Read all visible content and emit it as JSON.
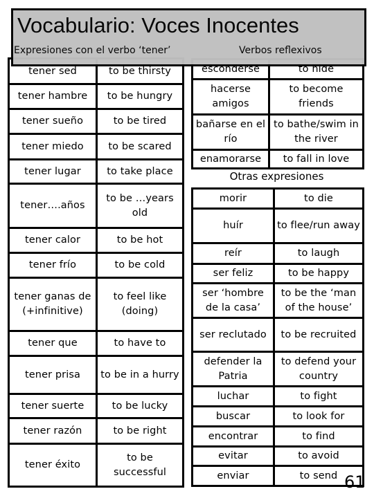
{
  "header": {
    "title": "Vocabulario: Voces Inocentes",
    "section_left": "Expresiones con el verbo ‘tener’",
    "section_right": "Verbos reflexivos"
  },
  "tener_expressions": [
    {
      "es": "tener sed",
      "en": "to be thirsty"
    },
    {
      "es": "tener hambre",
      "en": "to be hungry"
    },
    {
      "es": "tener sueño",
      "en": "to be tired"
    },
    {
      "es": "tener miedo",
      "en": "to be scared"
    },
    {
      "es": "tener lugar",
      "en": "to take place"
    },
    {
      "es": "tener….años",
      "en": "to be …years old"
    },
    {
      "es": "tener calor",
      "en": "to be hot"
    },
    {
      "es": "tener frío",
      "en": "to be cold"
    },
    {
      "es": "tener ganas de (+infinitive)",
      "en": "to feel like (doing)"
    },
    {
      "es": "tener que",
      "en": "to have to"
    },
    {
      "es": "tener prisa",
      "en": "to be in a hurry"
    },
    {
      "es": "tener suerte",
      "en": "to be lucky"
    },
    {
      "es": "tener razón",
      "en": "to be right"
    },
    {
      "es": "tener éxito",
      "en": "to be successful"
    }
  ],
  "reflexive_verbs": [
    {
      "es": "esconderse",
      "en": "to hide"
    },
    {
      "es": "hacerse amigos",
      "en": "to become friends"
    },
    {
      "es": "bañarse en el río",
      "en": "to bathe/swim in the river"
    },
    {
      "es": "enamorarse",
      "en": "to fall in love"
    }
  ],
  "otras": {
    "label": "Otras expresiones",
    "rows": [
      {
        "es": "morir",
        "en": "to die"
      },
      {
        "es": "huír",
        "en": "to flee/run away"
      },
      {
        "es": "reír",
        "en": "to laugh"
      },
      {
        "es": "ser feliz",
        "en": "to be happy"
      },
      {
        "es": "ser ‘hombre de la casa’",
        "en": "to be the ‘man of the house’"
      },
      {
        "es": "ser reclutado",
        "en": "to be recruited"
      },
      {
        "es": "defender la Patria",
        "en": "to defend your country"
      },
      {
        "es": "luchar",
        "en": "to fight"
      },
      {
        "es": "buscar",
        "en": "to look for"
      },
      {
        "es": "encontrar",
        "en": "to find"
      },
      {
        "es": "evitar",
        "en": "to avoid"
      },
      {
        "es": "enviar",
        "en": "to send"
      }
    ]
  },
  "page_number": "61"
}
